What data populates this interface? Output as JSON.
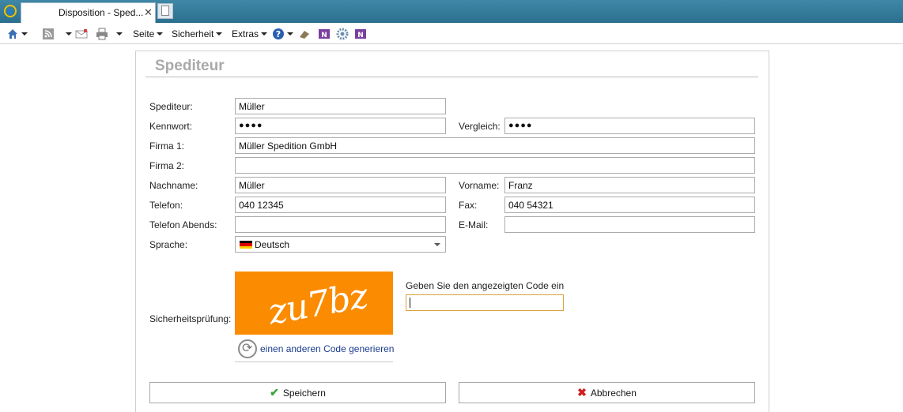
{
  "browser": {
    "tab_title": "Disposition - Sped...",
    "close_glyph": "✕",
    "menus": {
      "seite": "Seite",
      "sicherheit": "Sicherheit",
      "extras": "Extras"
    }
  },
  "form": {
    "title": "Spediteur",
    "labels": {
      "spediteur": "Spediteur:",
      "kennwort": "Kennwort:",
      "vergleich": "Vergleich:",
      "firma1": "Firma 1:",
      "firma2": "Firma 2:",
      "nachname": "Nachname:",
      "vorname": "Vorname:",
      "telefon": "Telefon:",
      "fax": "Fax:",
      "telefon_abends": "Telefon Abends:",
      "email": "E-Mail:",
      "sprache": "Sprache:",
      "sicherheit": "Sicherheitsprüfung:"
    },
    "values": {
      "spediteur": "Müller",
      "kennwort": "●●●●",
      "vergleich": "●●●●",
      "firma1": "Müller Spedition GmbH",
      "firma2": "",
      "nachname": "Müller",
      "vorname": "Franz",
      "telefon": "040 12345",
      "fax": "040 54321",
      "telefon_abends": "",
      "email": "",
      "sprache": "Deutsch"
    },
    "captcha": {
      "image_text": "zu7bz",
      "hint": "Geben Sie den angezeigten Code ein",
      "refresh_link": "einen anderen Code generieren",
      "code_value": ""
    },
    "buttons": {
      "save": "Speichern",
      "cancel": "Abbrechen"
    }
  },
  "colors": {
    "captcha_bg": "#fb8b00",
    "save_icon": "#3aa63a",
    "cancel_icon": "#d02020",
    "link": "#1a3c8f"
  }
}
